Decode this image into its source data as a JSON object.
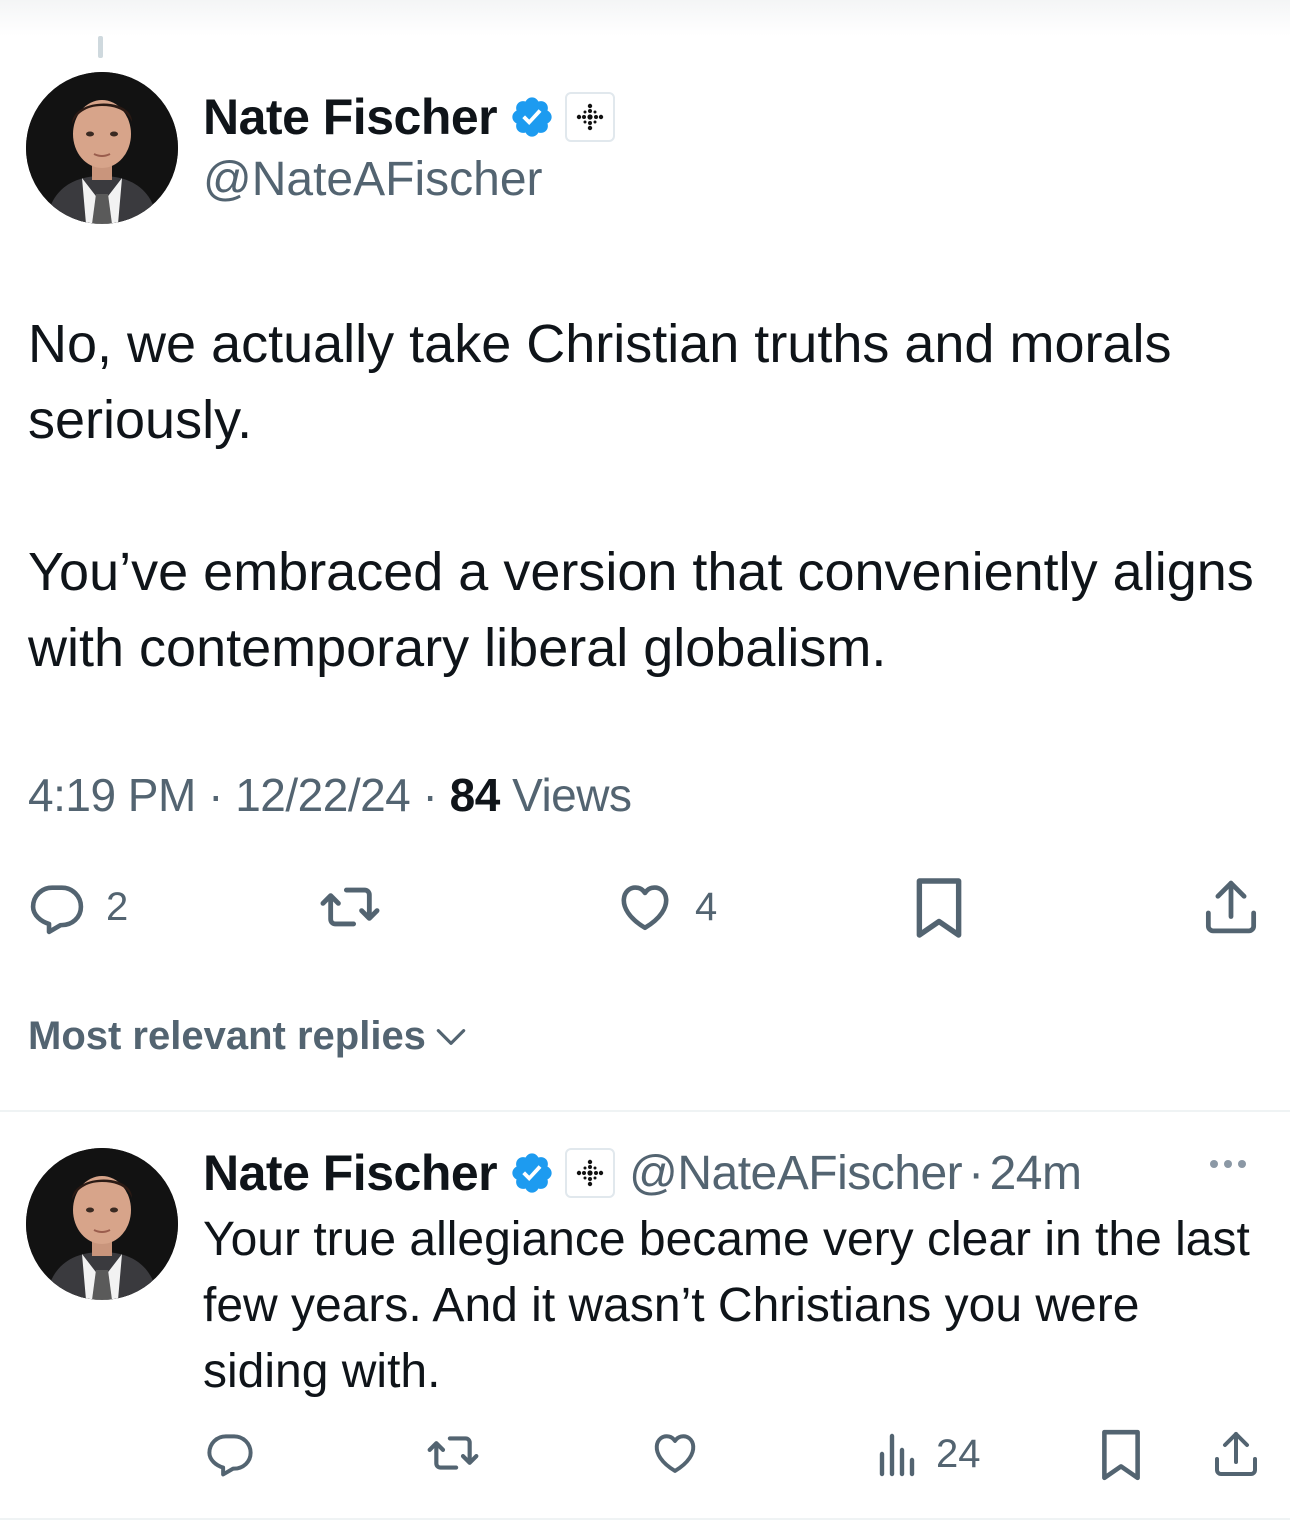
{
  "main_tweet": {
    "author": {
      "display_name": "Nate Fischer",
      "handle": "@NateAFischer",
      "verified_icon": "verified-badge-icon",
      "affiliation_icon": "affiliation-badge-icon"
    },
    "paragraphs": [
      "No, we actually take Christian truths and morals seriously.",
      "You’ve embraced a version that conveniently aligns with contemporary liberal globalism."
    ],
    "time": "4:19 PM",
    "separator": "·",
    "date": "12/22/24",
    "views_count": "84",
    "views_label": "Views",
    "actions": {
      "reply_count": "2",
      "retweet_count": "",
      "like_count": "4"
    }
  },
  "replies_sort": {
    "label": "Most relevant replies"
  },
  "reply": {
    "author": {
      "display_name": "Nate Fischer",
      "handle": "@NateAFischer",
      "separator": "·",
      "time_ago": "24m"
    },
    "text": "Your true allegiance became very clear in the last few years. And it wasn’t Christians you were siding with.",
    "actions": {
      "views_count": "24"
    }
  },
  "colors": {
    "text_primary": "#0f1419",
    "text_secondary": "#536471",
    "verified_blue": "#1d9bf0",
    "divider": "#eff3f4"
  }
}
